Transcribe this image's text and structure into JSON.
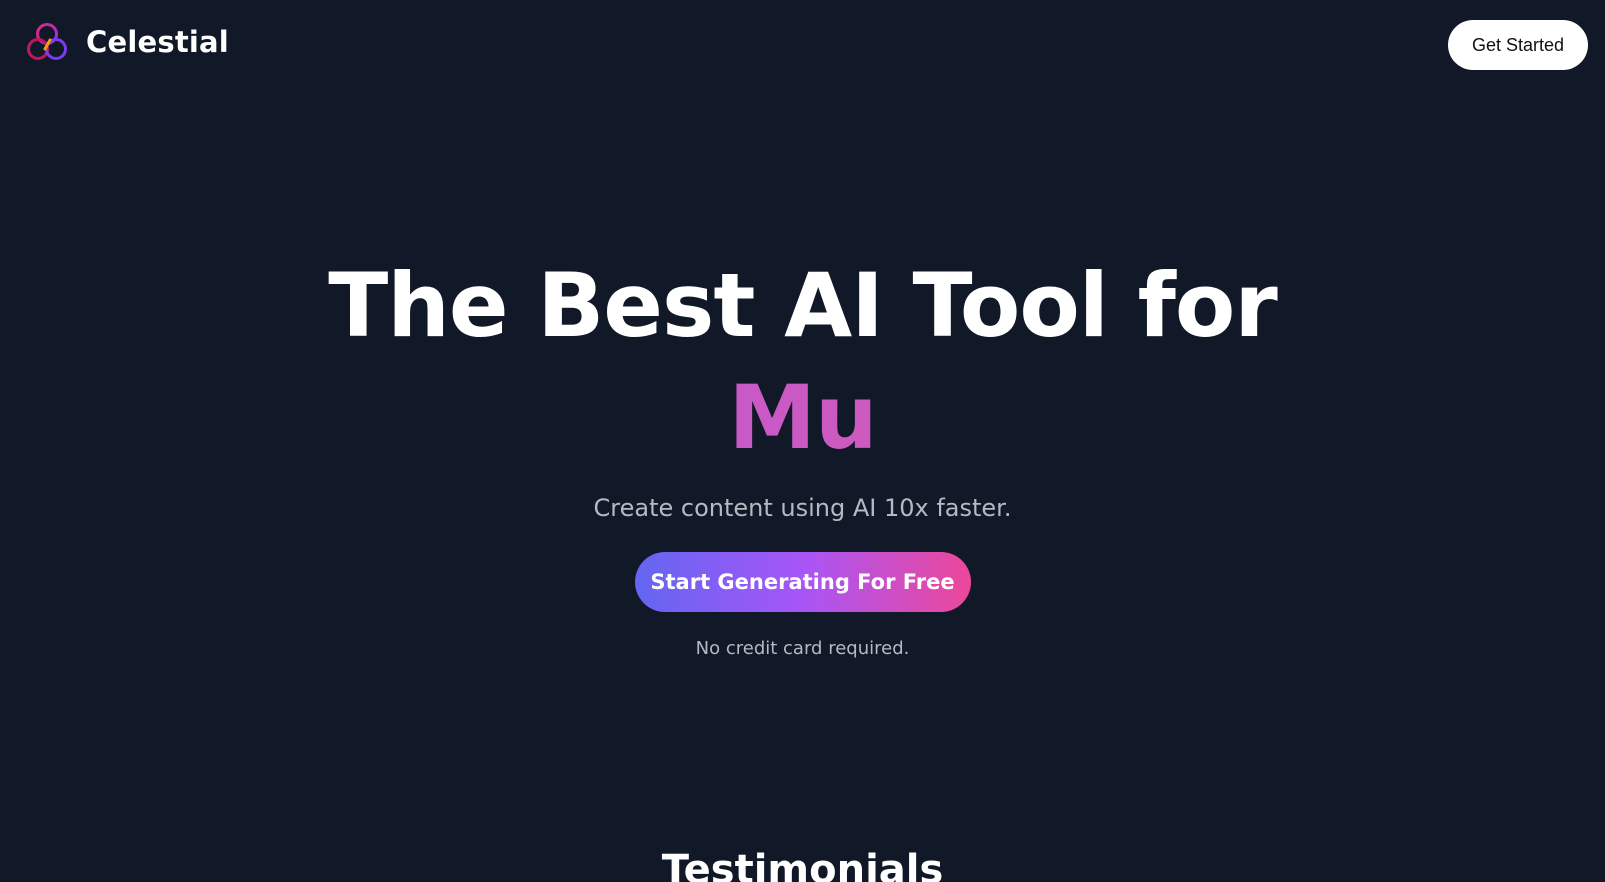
{
  "header": {
    "brand_name": "Celestial",
    "cta_label": "Get Started"
  },
  "hero": {
    "headline": "The Best AI Tool for",
    "rotating_word": "Mu",
    "subtitle": "Create content using AI 10x faster.",
    "cta_label": "Start Generating For Free",
    "note": "No credit card required."
  },
  "testimonials": {
    "title": "Testimonials"
  },
  "colors": {
    "background": "#111827",
    "accent_gradient": [
      "#6366f1",
      "#a855f7",
      "#ec4899"
    ],
    "rotating_word": "#c14fc4",
    "logo": [
      "#c026d3",
      "#7c3aed",
      "#f59e0b"
    ]
  },
  "icons": {
    "logo": "celestial-rings-logo-icon"
  }
}
